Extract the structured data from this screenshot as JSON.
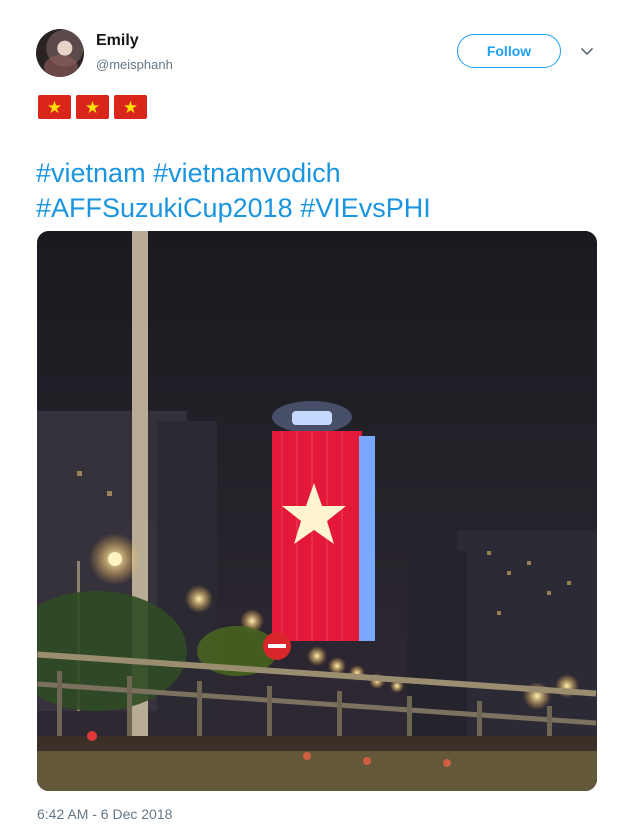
{
  "user": {
    "display_name": "Emily",
    "handle": "@meisphanh",
    "avatar_icon": "profile-photo"
  },
  "follow_button": {
    "label": "Follow"
  },
  "menu": {
    "icon": "chevron-down-icon"
  },
  "flags": [
    "flag-vn-emoji",
    "flag-vn-emoji",
    "flag-vn-emoji"
  ],
  "tweet": {
    "hashtags": [
      "#vietnam",
      "#vietnamvodich",
      "#AFFSuzukiCup2018",
      "#VIEvsPHI"
    ]
  },
  "media": {
    "description_icon": "photo"
  },
  "timestamp": "6:42 AM - 6 Dec 2018",
  "colors": {
    "accent": "#1da1f2",
    "link": "#1b95e0",
    "muted": "#657786",
    "flag_red": "#da251d",
    "flag_star": "#ffde00"
  }
}
